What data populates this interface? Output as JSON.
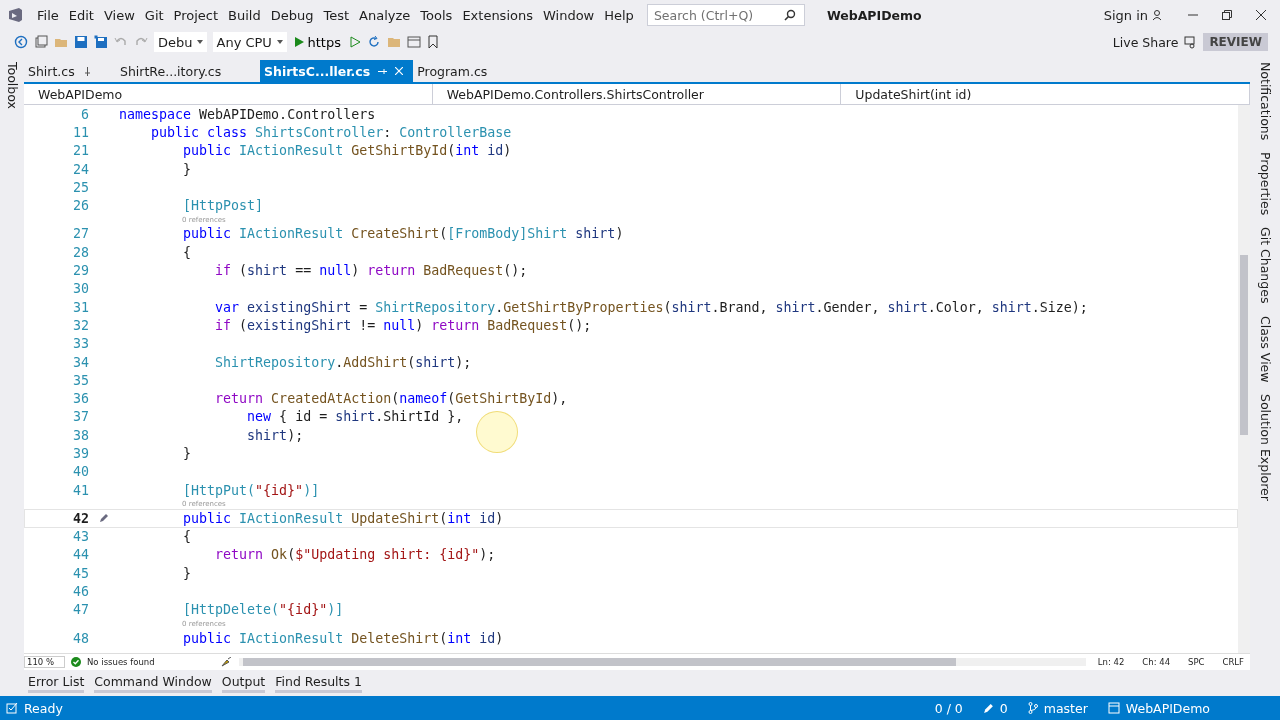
{
  "window": {
    "title": "WebAPIDemo",
    "sign_in": "Sign in"
  },
  "menu": [
    "File",
    "Edit",
    "View",
    "Git",
    "Project",
    "Build",
    "Debug",
    "Test",
    "Analyze",
    "Tools",
    "Extensions",
    "Window",
    "Help"
  ],
  "search": {
    "placeholder": "Search (Ctrl+Q)"
  },
  "toolbar": {
    "configuration": "Debu",
    "platform": "Any CPU",
    "run_target": "https",
    "live_share": "Live Share",
    "preview_badge": "REVIEW"
  },
  "left_panel_tabs": [
    "Toolbox"
  ],
  "document_tabs": [
    {
      "label": "Shirt.cs",
      "selected": false,
      "pinned": true
    },
    {
      "label": "ShirtRe...itory.cs",
      "selected": false,
      "pinned": false
    },
    {
      "label": "ShirtsC...ller.cs",
      "selected": true,
      "pinned": false
    },
    {
      "label": "Program.cs",
      "selected": false,
      "pinned": false
    }
  ],
  "navigation_bar": {
    "project": "WebAPIDemo",
    "type": "WebAPIDemo.Controllers.ShirtsController",
    "member": "UpdateShirt(int id)"
  },
  "code_lines": [
    {
      "kind": "code",
      "number": "6",
      "current": false,
      "tokens": [
        {
          "kind": "kw",
          "text": "namespace"
        },
        {
          "kind": "plain",
          "text": " WebAPIDemo.Controllers"
        }
      ]
    },
    {
      "kind": "code",
      "number": "11",
      "current": false,
      "tokens": [
        {
          "kind": "kw",
          "text": "    public class"
        },
        {
          "kind": "type",
          "text": " ShirtsController"
        },
        {
          "kind": "plain",
          "text": ": "
        },
        {
          "kind": "type",
          "text": "ControllerBase"
        }
      ]
    },
    {
      "kind": "code",
      "number": "21",
      "current": false,
      "tokens": [
        {
          "kind": "kw",
          "text": "        public"
        },
        {
          "kind": "type",
          "text": " IActionResult"
        },
        {
          "kind": "method",
          "text": " GetShirtById"
        },
        {
          "kind": "plain",
          "text": "("
        },
        {
          "kind": "kw",
          "text": "int"
        },
        {
          "kind": "param",
          "text": " id"
        },
        {
          "kind": "plain",
          "text": ")"
        }
      ]
    },
    {
      "kind": "code",
      "number": "24",
      "current": false,
      "tokens": [
        {
          "kind": "plain",
          "text": "        }"
        }
      ]
    },
    {
      "kind": "code",
      "number": "25",
      "current": false
    },
    {
      "kind": "code",
      "number": "26",
      "current": false,
      "tokens": [
        {
          "kind": "type",
          "text": "        [HttpPost]"
        }
      ]
    },
    {
      "kind": "lens",
      "text": "0 references"
    },
    {
      "kind": "code",
      "number": "27",
      "current": false,
      "tokens": [
        {
          "kind": "kw",
          "text": "        public"
        },
        {
          "kind": "type",
          "text": " IActionResult"
        },
        {
          "kind": "method",
          "text": " CreateShirt"
        },
        {
          "kind": "plain",
          "text": "("
        },
        {
          "kind": "type",
          "text": "[FromBody]Shirt"
        },
        {
          "kind": "param",
          "text": " shirt"
        },
        {
          "kind": "plain",
          "text": ")"
        }
      ]
    },
    {
      "kind": "code",
      "number": "28",
      "current": false,
      "tokens": [
        {
          "kind": "plain",
          "text": "        {"
        }
      ]
    },
    {
      "kind": "code",
      "number": "29",
      "current": false,
      "tokens": [
        {
          "kind": "ctrl",
          "text": "            if"
        },
        {
          "kind": "plain",
          "text": " ("
        },
        {
          "kind": "param",
          "text": "shirt"
        },
        {
          "kind": "plain",
          "text": " == "
        },
        {
          "kind": "kw",
          "text": "null"
        },
        {
          "kind": "plain",
          "text": ") "
        },
        {
          "kind": "ctrl",
          "text": "return"
        },
        {
          "kind": "method",
          "text": " BadRequest"
        },
        {
          "kind": "plain",
          "text": "();"
        }
      ]
    },
    {
      "kind": "code",
      "number": "30",
      "current": false
    },
    {
      "kind": "code",
      "number": "31",
      "current": false,
      "tokens": [
        {
          "kind": "kw",
          "text": "            var"
        },
        {
          "kind": "param",
          "text": " existingShirt"
        },
        {
          "kind": "plain",
          "text": " = "
        },
        {
          "kind": "type",
          "text": "ShirtRepository"
        },
        {
          "kind": "plain",
          "text": "."
        },
        {
          "kind": "method",
          "text": "GetShirtByProperties"
        },
        {
          "kind": "plain",
          "text": "("
        },
        {
          "kind": "param",
          "text": "shirt"
        },
        {
          "kind": "plain",
          "text": ".Brand, "
        },
        {
          "kind": "param",
          "text": "shirt"
        },
        {
          "kind": "plain",
          "text": ".Gender, "
        },
        {
          "kind": "param",
          "text": "shirt"
        },
        {
          "kind": "plain",
          "text": ".Color, "
        },
        {
          "kind": "param",
          "text": "shirt"
        },
        {
          "kind": "plain",
          "text": ".Size);"
        }
      ]
    },
    {
      "kind": "code",
      "number": "32",
      "current": false,
      "tokens": [
        {
          "kind": "ctrl",
          "text": "            if"
        },
        {
          "kind": "plain",
          "text": " ("
        },
        {
          "kind": "param",
          "text": "existingShirt"
        },
        {
          "kind": "plain",
          "text": " != "
        },
        {
          "kind": "kw",
          "text": "null"
        },
        {
          "kind": "plain",
          "text": ") "
        },
        {
          "kind": "ctrl",
          "text": "return"
        },
        {
          "kind": "method",
          "text": " BadRequest"
        },
        {
          "kind": "plain",
          "text": "();"
        }
      ]
    },
    {
      "kind": "code",
      "number": "33",
      "current": false
    },
    {
      "kind": "code",
      "number": "34",
      "current": false,
      "tokens": [
        {
          "kind": "type",
          "text": "            ShirtRepository"
        },
        {
          "kind": "plain",
          "text": "."
        },
        {
          "kind": "method",
          "text": "AddShirt"
        },
        {
          "kind": "plain",
          "text": "("
        },
        {
          "kind": "param",
          "text": "shirt"
        },
        {
          "kind": "plain",
          "text": ");"
        }
      ]
    },
    {
      "kind": "code",
      "number": "35",
      "current": false
    },
    {
      "kind": "code",
      "number": "36",
      "current": false,
      "tokens": [
        {
          "kind": "ctrl",
          "text": "            return"
        },
        {
          "kind": "method",
          "text": " CreatedAtAction"
        },
        {
          "kind": "plain",
          "text": "("
        },
        {
          "kind": "kw",
          "text": "nameof"
        },
        {
          "kind": "plain",
          "text": "("
        },
        {
          "kind": "method",
          "text": "GetShirtById"
        },
        {
          "kind": "plain",
          "text": "),"
        }
      ]
    },
    {
      "kind": "code",
      "number": "37",
      "current": false,
      "tokens": [
        {
          "kind": "kw",
          "text": "                new"
        },
        {
          "kind": "plain",
          "text": " { id = "
        },
        {
          "kind": "param",
          "text": "shirt"
        },
        {
          "kind": "plain",
          "text": ".ShirtId },"
        }
      ]
    },
    {
      "kind": "code",
      "number": "38",
      "current": false,
      "tokens": [
        {
          "kind": "param",
          "text": "                shirt"
        },
        {
          "kind": "plain",
          "text": ");"
        }
      ]
    },
    {
      "kind": "code",
      "number": "39",
      "current": false,
      "tokens": [
        {
          "kind": "plain",
          "text": "        }"
        }
      ]
    },
    {
      "kind": "code",
      "number": "40",
      "current": false
    },
    {
      "kind": "code",
      "number": "41",
      "current": false,
      "tokens": [
        {
          "kind": "type",
          "text": "        [HttpPut("
        },
        {
          "kind": "str",
          "text": "\"{id}\""
        },
        {
          "kind": "type",
          "text": ")]"
        }
      ]
    },
    {
      "kind": "lens",
      "text": "0 references"
    },
    {
      "kind": "code",
      "number": "42",
      "current": true,
      "tokens": [
        {
          "kind": "kw",
          "text": "        public"
        },
        {
          "kind": "type",
          "text": " IActionResult"
        },
        {
          "kind": "method",
          "text": " UpdateShirt"
        },
        {
          "kind": "plain",
          "text": "("
        },
        {
          "kind": "kw",
          "text": "int"
        },
        {
          "kind": "param",
          "text": " id"
        },
        {
          "kind": "plain",
          "text": ")"
        }
      ]
    },
    {
      "kind": "code",
      "number": "43",
      "current": false,
      "tokens": [
        {
          "kind": "plain",
          "text": "        {"
        }
      ]
    },
    {
      "kind": "code",
      "number": "44",
      "current": false,
      "tokens": [
        {
          "kind": "ctrl",
          "text": "            return"
        },
        {
          "kind": "method",
          "text": " Ok"
        },
        {
          "kind": "plain",
          "text": "("
        },
        {
          "kind": "str",
          "text": "$\"Updating shirt: {id}\""
        },
        {
          "kind": "plain",
          "text": ");"
        }
      ]
    },
    {
      "kind": "code",
      "number": "45",
      "current": false,
      "tokens": [
        {
          "kind": "plain",
          "text": "        }"
        }
      ]
    },
    {
      "kind": "code",
      "number": "46",
      "current": false
    },
    {
      "kind": "code",
      "number": "47",
      "current": false,
      "tokens": [
        {
          "kind": "type",
          "text": "        [HttpDelete("
        },
        {
          "kind": "str",
          "text": "\"{id}\""
        },
        {
          "kind": "type",
          "text": ")]"
        }
      ]
    },
    {
      "kind": "lens",
      "text": "0 references"
    },
    {
      "kind": "code",
      "number": "48",
      "current": false,
      "tokens": [
        {
          "kind": "kw",
          "text": "        public"
        },
        {
          "kind": "type",
          "text": " IActionResult"
        },
        {
          "kind": "method",
          "text": " DeleteShirt"
        },
        {
          "kind": "plain",
          "text": "("
        },
        {
          "kind": "kw",
          "text": "int"
        },
        {
          "kind": "param",
          "text": " id"
        },
        {
          "kind": "plain",
          "text": ")"
        }
      ]
    }
  ],
  "editor_status": {
    "zoom": "110 %",
    "issues": "No issues found",
    "line": "Ln: 42",
    "column": "Ch: 44",
    "whitespace": "SPC",
    "line_ending": "CRLF"
  },
  "bottom_tabs": [
    "Error List",
    "Command Window",
    "Output",
    "Find Results 1"
  ],
  "status_bar": {
    "message": "Ready",
    "sync": "0 / 0",
    "changes": "0",
    "branch": "master",
    "repository": "WebAPIDemo"
  },
  "right_panel_tabs": [
    "Notifications",
    "Properties",
    "Git Changes",
    "Class View",
    "Solution Explorer"
  ]
}
